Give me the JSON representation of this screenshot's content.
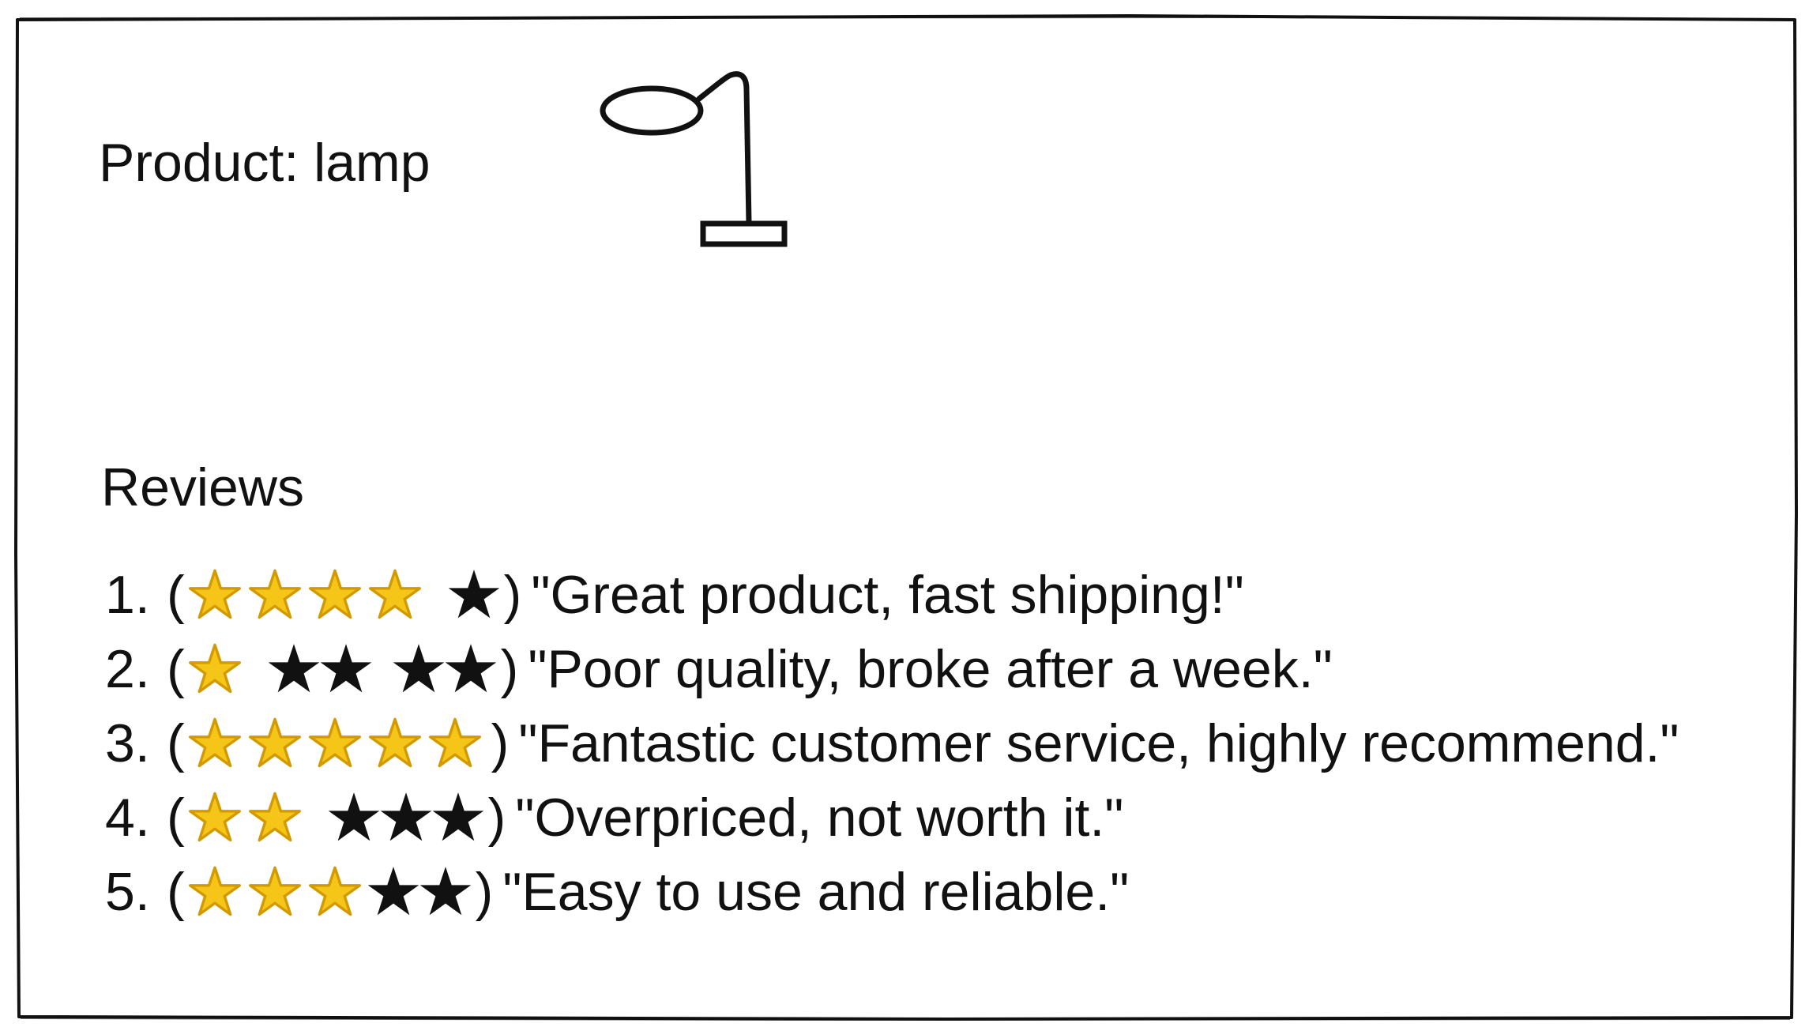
{
  "product": {
    "label": "Product: lamp",
    "icon": "lamp-icon"
  },
  "reviews": {
    "heading": "Reviews",
    "items": [
      {
        "number": "1.",
        "text": "\"Great product, fast shipping!\"",
        "rating": 4,
        "outline_stars": 4,
        "filled_stars": 1,
        "gap_after": 4
      },
      {
        "number": "2.",
        "text": "\"Poor quality, broke after a week.\"",
        "rating": 1,
        "outline_stars": 1,
        "filled_stars": 4,
        "gap_after": [
          1,
          3
        ]
      },
      {
        "number": "3.",
        "text": "\"Fantastic customer service, highly recommend.\"",
        "rating": 5,
        "outline_stars": 5,
        "filled_stars": 0,
        "gap_after": []
      },
      {
        "number": "4.",
        "text": "\"Overpriced, not worth it.\"",
        "rating": 2,
        "outline_stars": 2,
        "filled_stars": 3,
        "gap_after": [
          2
        ]
      },
      {
        "number": "5.",
        "text": "\"Easy to use and reliable.\"",
        "rating": 3,
        "outline_stars": 3,
        "filled_stars": 2,
        "gap_after": []
      }
    ]
  },
  "colors": {
    "star_gold": "#f5c518",
    "star_outline": "#d29a00",
    "ink": "#111111"
  }
}
